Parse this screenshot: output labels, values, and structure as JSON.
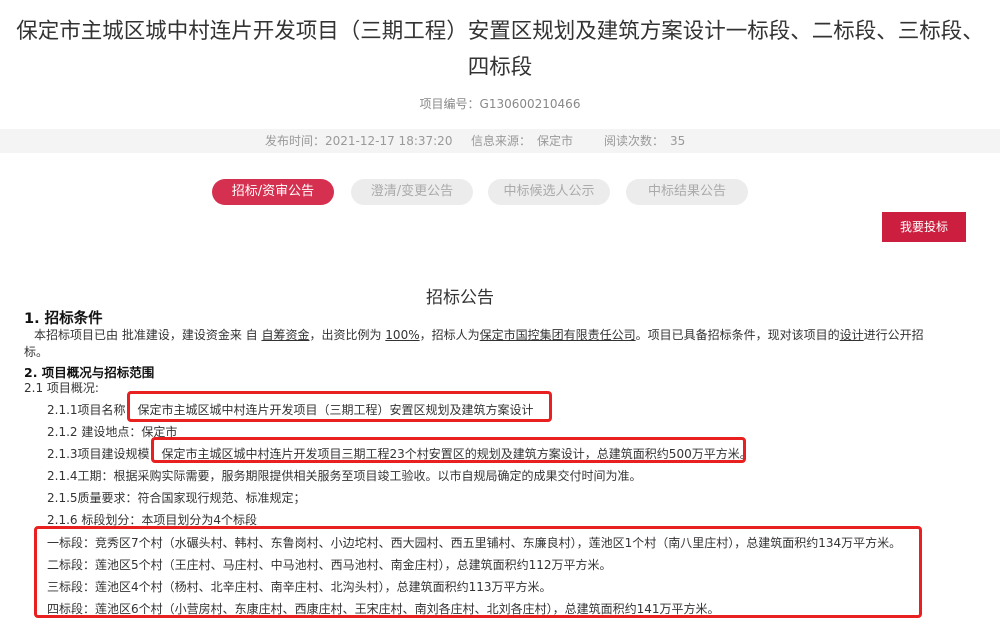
{
  "header": {
    "title_line1": "保定市主城区城中村连片开发项目（三期工程）安置区规划及建筑方案设计一标段、二标段、三标段、",
    "title_line2": "四标段",
    "project_code": "项目编号：G130600210466"
  },
  "meta": {
    "publish_label": "发布时间：",
    "publish_time": "2021-12-17 18:37:20",
    "source_label": "信息来源：",
    "source": "保定市",
    "views_label": "阅读次数：",
    "views": "35"
  },
  "tabs": [
    {
      "label": "招标/资审公告",
      "active": true
    },
    {
      "label": "澄清/变更公告",
      "active": false
    },
    {
      "label": "中标候选人公示",
      "active": false
    },
    {
      "label": "中标结果公告",
      "active": false
    }
  ],
  "bid_button": "我要投标",
  "notice": {
    "title": "招标公告",
    "sec1_heading": "1. 招标条件",
    "sec1_parts": [
      "本招标项目已由 批准建设，建设资金来 自 ",
      "自筹资金",
      "，出资比例为 ",
      "100%",
      "，招标人为",
      "保定市国控集团有限责任公司",
      "。项目已具备招标条件，现对该项目的",
      "设计",
      "进行公开招"
    ],
    "sec1_tail": "标。",
    "sec2_heading": "2. 项目概况与招标范围",
    "sub_2_1": "2.1 项目概况:",
    "item_name": "2.1.1项目名称：保定市主城区城中村连片开发项目（三期工程）安置区规划及建筑方案设计",
    "item_location": "2.1.2 建设地点：保定市",
    "item_scale": "2.1.3项目建设规模：保定市主城区城中村连片开发项目三期工程23个村安置区的规划及建筑方案设计，总建筑面积约500万平方米。",
    "item_period": "2.1.4工期：根据采购实际需要，服务期限提供相关服务至项目竣工验收。以市自规局确定的成果交付时间为准。",
    "item_quality": "2.1.5质量要求：符合国家现行规范、标准规定；",
    "item_lots": "2.1.6 标段划分：本项目划分为4个标段",
    "lots": [
      "一标段：竞秀区7个村（水碾头村、韩村、东鲁岗村、小边坨村、西大园村、西五里铺村、东廉良村），莲池区1个村（南八里庄村），总建筑面积约134万平方米。",
      "二标段：莲池区5个村（王庄村、马庄村、中马池村、西马池村、南金庄村），总建筑面积约112万平方米。",
      "三标段：莲池区4个村（杨村、北辛庄村、南辛庄村、北沟头村），总建筑面积约113万平方米。",
      "四标段：莲池区6个村（小营房村、东康庄村、西康庄村、王宋庄村、南刘各庄村、北刘各庄村），总建筑面积约141万平方米。"
    ]
  },
  "colors": {
    "accent": "#d5304f",
    "button": "#cc1f3f",
    "highlight_box": "#e8201f"
  }
}
